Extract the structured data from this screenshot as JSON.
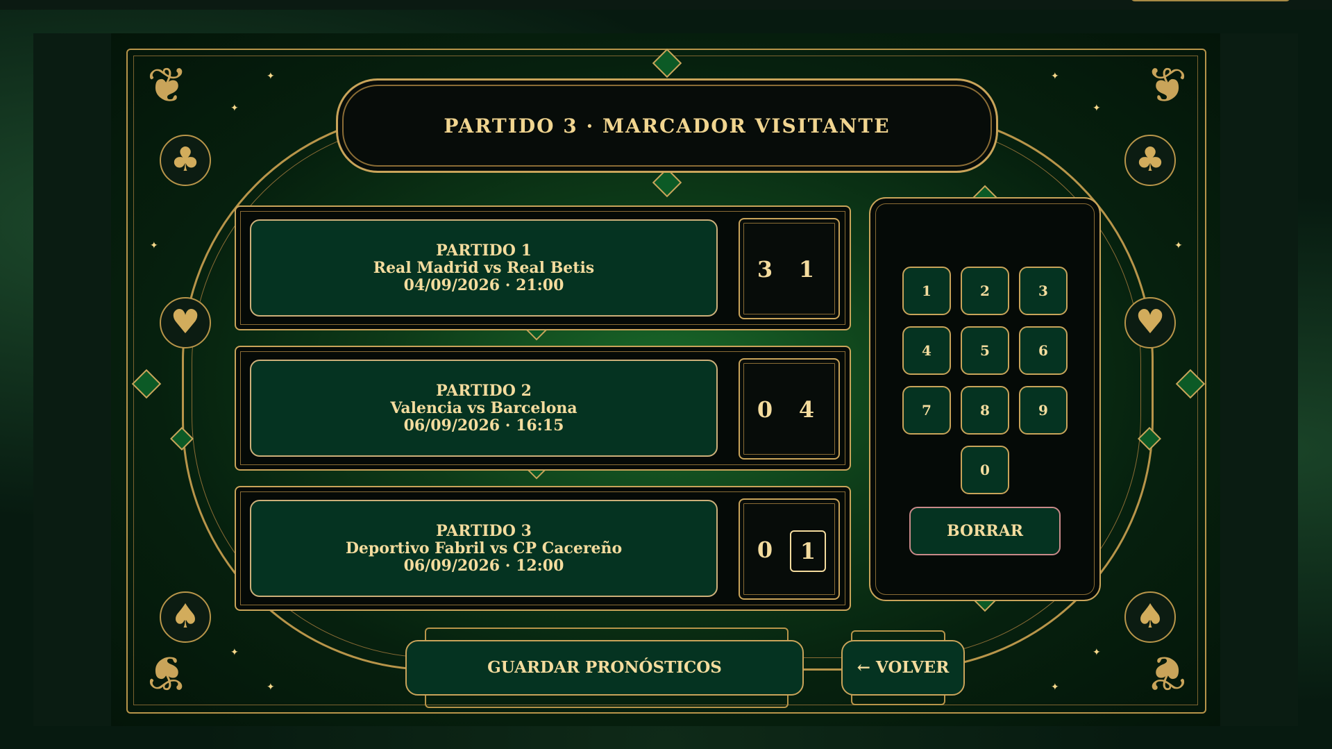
{
  "title": "PARTIDO 3 · MARCADOR VISITANTE",
  "matches": [
    {
      "label": "PARTIDO 1",
      "teams": "Real Madrid  vs  Real Betis",
      "datetime": "04/09/2026 · 21:00",
      "home": "3",
      "away": "1"
    },
    {
      "label": "PARTIDO 2",
      "teams": "Valencia  vs  Barcelona",
      "datetime": "06/09/2026 · 16:15",
      "home": "0",
      "away": "4"
    },
    {
      "label": "PARTIDO 3",
      "teams": "Deportivo Fabril  vs  CP Cacereño",
      "datetime": "06/09/2026 · 12:00",
      "home": "0",
      "away": "1"
    }
  ],
  "keypad": {
    "keys": [
      "1",
      "2",
      "3",
      "4",
      "5",
      "6",
      "7",
      "8",
      "9",
      "0"
    ],
    "clear": "BORRAR"
  },
  "actions": {
    "save": "GUARDAR PRONÓSTICOS",
    "back": "← VOLVER"
  },
  "suits": {
    "club": "♣",
    "heart": "♥",
    "spade": "♠"
  },
  "colors": {
    "gold": "#c9a45a",
    "felt": "#0d3a18",
    "panel": "#053321",
    "text": "#f4dc9e"
  }
}
